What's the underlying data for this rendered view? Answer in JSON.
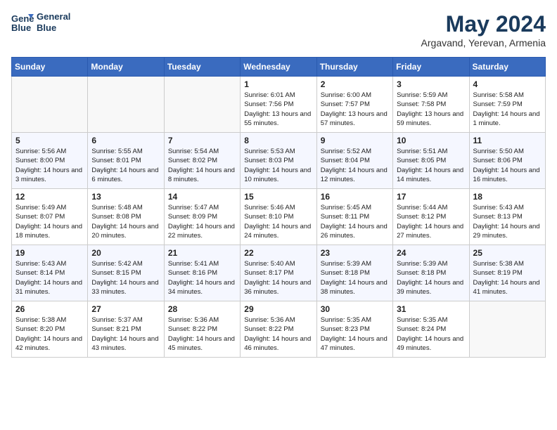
{
  "header": {
    "logo_line1": "General",
    "logo_line2": "Blue",
    "month": "May 2024",
    "location": "Argavand, Yerevan, Armenia"
  },
  "weekdays": [
    "Sunday",
    "Monday",
    "Tuesday",
    "Wednesday",
    "Thursday",
    "Friday",
    "Saturday"
  ],
  "weeks": [
    [
      {
        "day": "",
        "info": ""
      },
      {
        "day": "",
        "info": ""
      },
      {
        "day": "",
        "info": ""
      },
      {
        "day": "1",
        "info": "Sunrise: 6:01 AM\nSunset: 7:56 PM\nDaylight: 13 hours\nand 55 minutes."
      },
      {
        "day": "2",
        "info": "Sunrise: 6:00 AM\nSunset: 7:57 PM\nDaylight: 13 hours\nand 57 minutes."
      },
      {
        "day": "3",
        "info": "Sunrise: 5:59 AM\nSunset: 7:58 PM\nDaylight: 13 hours\nand 59 minutes."
      },
      {
        "day": "4",
        "info": "Sunrise: 5:58 AM\nSunset: 7:59 PM\nDaylight: 14 hours\nand 1 minute."
      }
    ],
    [
      {
        "day": "5",
        "info": "Sunrise: 5:56 AM\nSunset: 8:00 PM\nDaylight: 14 hours\nand 3 minutes."
      },
      {
        "day": "6",
        "info": "Sunrise: 5:55 AM\nSunset: 8:01 PM\nDaylight: 14 hours\nand 6 minutes."
      },
      {
        "day": "7",
        "info": "Sunrise: 5:54 AM\nSunset: 8:02 PM\nDaylight: 14 hours\nand 8 minutes."
      },
      {
        "day": "8",
        "info": "Sunrise: 5:53 AM\nSunset: 8:03 PM\nDaylight: 14 hours\nand 10 minutes."
      },
      {
        "day": "9",
        "info": "Sunrise: 5:52 AM\nSunset: 8:04 PM\nDaylight: 14 hours\nand 12 minutes."
      },
      {
        "day": "10",
        "info": "Sunrise: 5:51 AM\nSunset: 8:05 PM\nDaylight: 14 hours\nand 14 minutes."
      },
      {
        "day": "11",
        "info": "Sunrise: 5:50 AM\nSunset: 8:06 PM\nDaylight: 14 hours\nand 16 minutes."
      }
    ],
    [
      {
        "day": "12",
        "info": "Sunrise: 5:49 AM\nSunset: 8:07 PM\nDaylight: 14 hours\nand 18 minutes."
      },
      {
        "day": "13",
        "info": "Sunrise: 5:48 AM\nSunset: 8:08 PM\nDaylight: 14 hours\nand 20 minutes."
      },
      {
        "day": "14",
        "info": "Sunrise: 5:47 AM\nSunset: 8:09 PM\nDaylight: 14 hours\nand 22 minutes."
      },
      {
        "day": "15",
        "info": "Sunrise: 5:46 AM\nSunset: 8:10 PM\nDaylight: 14 hours\nand 24 minutes."
      },
      {
        "day": "16",
        "info": "Sunrise: 5:45 AM\nSunset: 8:11 PM\nDaylight: 14 hours\nand 26 minutes."
      },
      {
        "day": "17",
        "info": "Sunrise: 5:44 AM\nSunset: 8:12 PM\nDaylight: 14 hours\nand 27 minutes."
      },
      {
        "day": "18",
        "info": "Sunrise: 5:43 AM\nSunset: 8:13 PM\nDaylight: 14 hours\nand 29 minutes."
      }
    ],
    [
      {
        "day": "19",
        "info": "Sunrise: 5:43 AM\nSunset: 8:14 PM\nDaylight: 14 hours\nand 31 minutes."
      },
      {
        "day": "20",
        "info": "Sunrise: 5:42 AM\nSunset: 8:15 PM\nDaylight: 14 hours\nand 33 minutes."
      },
      {
        "day": "21",
        "info": "Sunrise: 5:41 AM\nSunset: 8:16 PM\nDaylight: 14 hours\nand 34 minutes."
      },
      {
        "day": "22",
        "info": "Sunrise: 5:40 AM\nSunset: 8:17 PM\nDaylight: 14 hours\nand 36 minutes."
      },
      {
        "day": "23",
        "info": "Sunrise: 5:39 AM\nSunset: 8:18 PM\nDaylight: 14 hours\nand 38 minutes."
      },
      {
        "day": "24",
        "info": "Sunrise: 5:39 AM\nSunset: 8:18 PM\nDaylight: 14 hours\nand 39 minutes."
      },
      {
        "day": "25",
        "info": "Sunrise: 5:38 AM\nSunset: 8:19 PM\nDaylight: 14 hours\nand 41 minutes."
      }
    ],
    [
      {
        "day": "26",
        "info": "Sunrise: 5:38 AM\nSunset: 8:20 PM\nDaylight: 14 hours\nand 42 minutes."
      },
      {
        "day": "27",
        "info": "Sunrise: 5:37 AM\nSunset: 8:21 PM\nDaylight: 14 hours\nand 43 minutes."
      },
      {
        "day": "28",
        "info": "Sunrise: 5:36 AM\nSunset: 8:22 PM\nDaylight: 14 hours\nand 45 minutes."
      },
      {
        "day": "29",
        "info": "Sunrise: 5:36 AM\nSunset: 8:22 PM\nDaylight: 14 hours\nand 46 minutes."
      },
      {
        "day": "30",
        "info": "Sunrise: 5:35 AM\nSunset: 8:23 PM\nDaylight: 14 hours\nand 47 minutes."
      },
      {
        "day": "31",
        "info": "Sunrise: 5:35 AM\nSunset: 8:24 PM\nDaylight: 14 hours\nand 49 minutes."
      },
      {
        "day": "",
        "info": ""
      }
    ]
  ]
}
